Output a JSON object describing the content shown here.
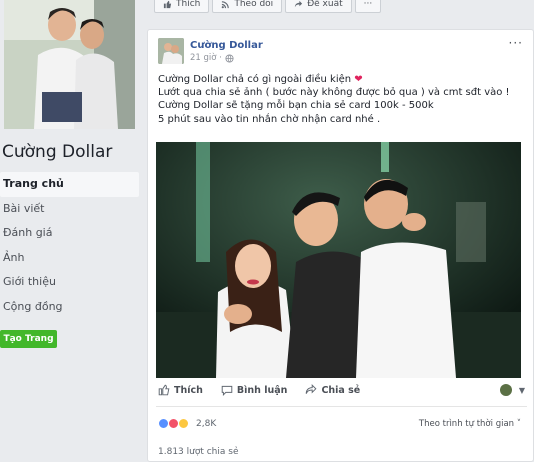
{
  "sidebar": {
    "page_name": "Cường Dollar",
    "items": [
      {
        "label": "Trang chủ",
        "active": true
      },
      {
        "label": "Bài viết"
      },
      {
        "label": "Đánh giá"
      },
      {
        "label": "Ảnh"
      },
      {
        "label": "Giới thiệu"
      },
      {
        "label": "Cộng đồng"
      }
    ],
    "create_button": "Tạo Trang"
  },
  "topbar": {
    "like_label": "Thích",
    "follow_label": "Theo dõi",
    "suggest_label": "Đề xuất",
    "more_label": "···"
  },
  "post": {
    "author": "Cường Dollar",
    "time": "21 giờ ·",
    "more": "···",
    "lines": [
      "Cường Dollar chả có gì ngoài điều kiện",
      "Lướt qua chia sẻ ảnh ( bước này không được bỏ qua ) và cmt sđt vào !",
      "Cường Dollar sẽ tặng mỗi bạn chia sẻ card 100k - 500k",
      "5 phút sau vào tin nhắn chờ nhận card nhé ."
    ],
    "heart": "❤",
    "actions": {
      "like": "Thích",
      "comment": "Bình luận",
      "share": "Chia sẻ"
    },
    "reaction_count": "2,8K",
    "sort_label": "Theo trình tự thời gian ˅",
    "shares_label": "1.813 lượt chia sẻ"
  },
  "colors": {
    "link_blue": "#365899",
    "green_button": "#42b72a",
    "background": "#e9ebee"
  }
}
